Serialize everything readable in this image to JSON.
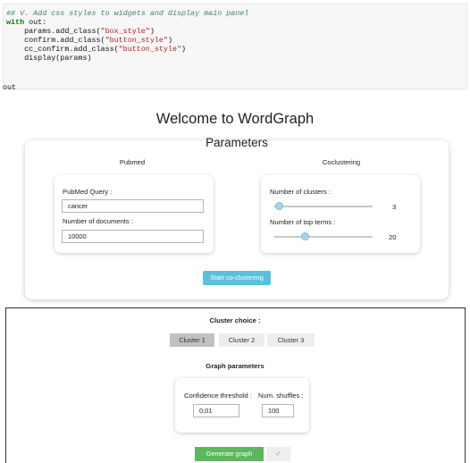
{
  "code_cell": {
    "line1": "## V. Add css styles to widgets and display main panel",
    "line2_kw": "with",
    "line2_rest": " out:",
    "line3_pre": "    params.add_class(",
    "line3_str": "\"box_style\"",
    "line3_post": ")",
    "line4_pre": "    confirm.add_class(",
    "line4_str": "\"button_style\"",
    "line4_post": ")",
    "line5_pre": "    cc_confirm.add_class(",
    "line5_str": "\"button_style\"",
    "line5_post": ")",
    "line6": "    display(params)",
    "line7": "out"
  },
  "welcome_title": "Welcome to WordGraph",
  "parameters": {
    "title": "Parameters",
    "pubmed": {
      "title": "Pubmed",
      "query_label": "PubMed Query :",
      "query_value": "cancer",
      "docs_label": "Number of documents :",
      "docs_value": "10000"
    },
    "coclustering": {
      "title": "Coclustering",
      "clusters_label": "Number of clusters :",
      "clusters_value": "3",
      "clusters_fraction": 0.02,
      "terms_label": "Number of top terms :",
      "terms_value": "20",
      "terms_fraction": 0.3
    },
    "start_button": "Start co-clustering"
  },
  "cluster_choice": {
    "title": "Cluster choice :",
    "options": [
      "Cluster 1",
      "Cluster 2",
      "Cluster 3"
    ],
    "selected": "Cluster 1"
  },
  "graph_parameters": {
    "title": "Graph parameters",
    "confidence_label": "Confidence threshold :",
    "confidence_value": "0,01",
    "shuffles_label": "Num. shuffles :",
    "shuffles_value": "100"
  },
  "actions": {
    "generate_label": "Generate graph",
    "check_label": "✓"
  },
  "colors": {
    "primary_button": "#5bc0de",
    "success_button": "#5cb85c",
    "selected_toggle": "#c1c1c1"
  }
}
